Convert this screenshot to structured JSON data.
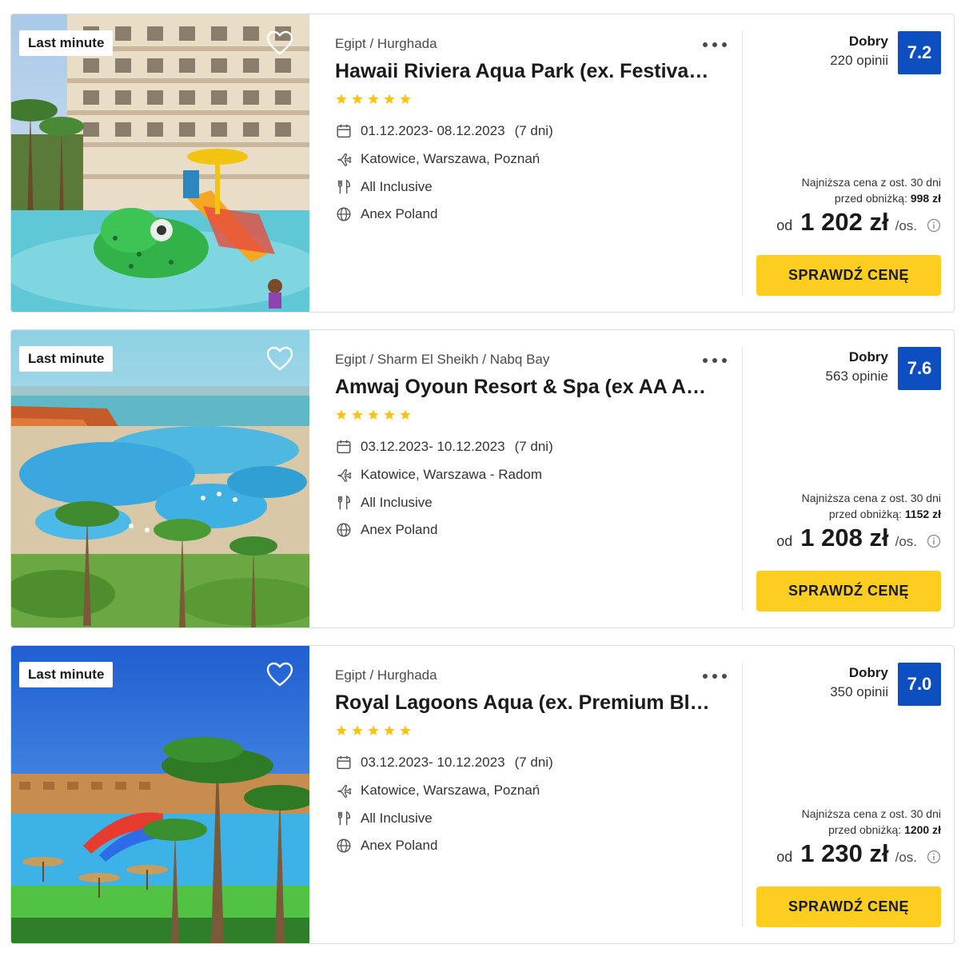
{
  "colors": {
    "score_bg": "#0d4ec0",
    "cta_bg": "#fdce1f",
    "star": "#fcc419"
  },
  "offers": [
    {
      "badge": "Last minute",
      "breadcrumb": "Egipt / Hurghada",
      "title": "Hawaii Riviera Aqua Park (ex. Festiva…",
      "stars": 5,
      "dates": "01.12.2023- 08.12.2023",
      "nights": "(7 dni)",
      "departure": "Katowice, Warszawa, Poznań",
      "board": "All Inclusive",
      "operator": "Anex Poland",
      "rating_label": "Dobry",
      "rating_count": "220 opinii",
      "score": "7.2",
      "lowest_line1": "Najniższa cena z ost. 30 dni",
      "lowest_line2_label": "przed obniżką:",
      "lowest_line2_value": "998 zł",
      "price_prefix": "od",
      "price": "1 202 zł",
      "price_unit": "/os.",
      "cta": "SPRAWDŹ CENĘ"
    },
    {
      "badge": "Last minute",
      "breadcrumb": "Egipt / Sharm El Sheikh / Nabq Bay",
      "title": "Amwaj Oyoun Resort & Spa (ex AA A…",
      "stars": 5,
      "dates": "03.12.2023- 10.12.2023",
      "nights": "(7 dni)",
      "departure": "Katowice, Warszawa - Radom",
      "board": "All Inclusive",
      "operator": "Anex Poland",
      "rating_label": "Dobry",
      "rating_count": "563 opinie",
      "score": "7.6",
      "lowest_line1": "Najniższa cena z ost. 30 dni",
      "lowest_line2_label": "przed obniżką:",
      "lowest_line2_value": "1152 zł",
      "price_prefix": "od",
      "price": "1 208 zł",
      "price_unit": "/os.",
      "cta": "SPRAWDŹ CENĘ"
    },
    {
      "badge": "Last minute",
      "breadcrumb": "Egipt / Hurghada",
      "title": "Royal Lagoons Aqua (ex. Premium Bl…",
      "stars": 5,
      "dates": "03.12.2023- 10.12.2023",
      "nights": "(7 dni)",
      "departure": "Katowice, Warszawa, Poznań",
      "board": "All Inclusive",
      "operator": "Anex Poland",
      "rating_label": "Dobry",
      "rating_count": "350 opinii",
      "score": "7.0",
      "lowest_line1": "Najniższa cena z ost. 30 dni",
      "lowest_line2_label": "przed obniżką:",
      "lowest_line2_value": "1200 zł",
      "price_prefix": "od",
      "price": "1 230 zł",
      "price_unit": "/os.",
      "cta": "SPRAWDŹ CENĘ"
    }
  ]
}
